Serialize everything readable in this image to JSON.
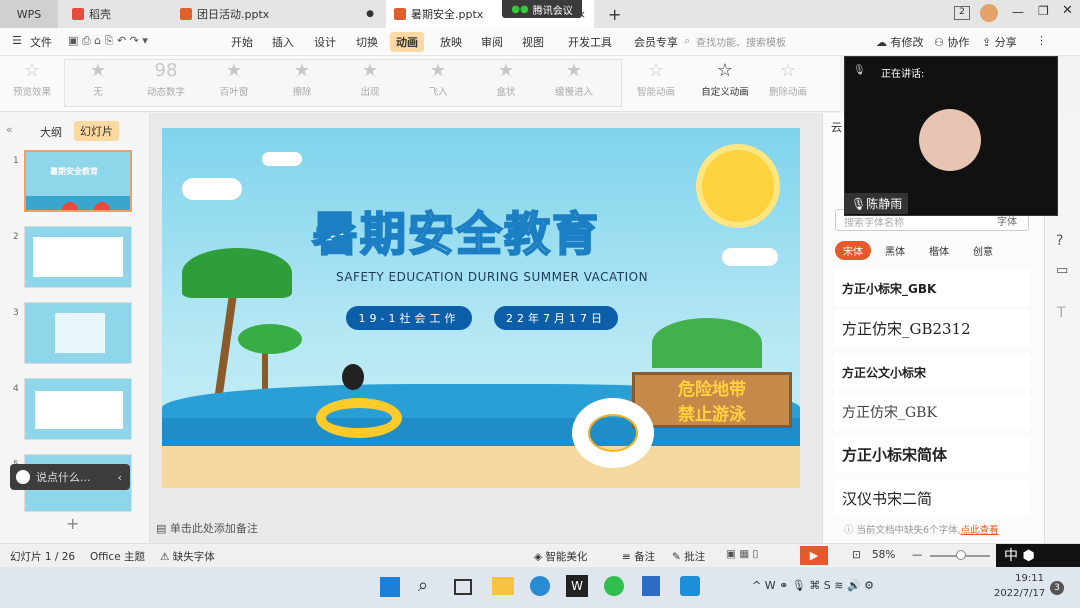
{
  "tabs": {
    "wps": "WPS",
    "docer": "稻壳",
    "file1": "团日活动.pptx",
    "file2": "暑期安全.pptx",
    "add": "+"
  },
  "meeting_badge": "腾讯会议",
  "window_controls": {
    "num": "2"
  },
  "menubar": {
    "file": "文件",
    "items": [
      "开始",
      "插入",
      "设计",
      "切换",
      "动画",
      "放映",
      "审阅",
      "视图",
      "开发工具",
      "会员专享"
    ],
    "search": "查找功能、搜索模板",
    "changes": "有修改",
    "collab": "协作",
    "share": "分享"
  },
  "ribbon": {
    "preview": "预览效果",
    "effects": [
      "无",
      "动态数字",
      "百叶窗",
      "擦除",
      "出现",
      "飞入",
      "盒状",
      "缓慢进入"
    ],
    "smart": "智能动画",
    "custom": "自定义动画",
    "delete": "删除动画"
  },
  "left_panel": {
    "outline": "大纲",
    "slides": "幻灯片",
    "nums": [
      "1",
      "2",
      "3",
      "4",
      "5"
    ],
    "chat": "说点什么...",
    "add": "+"
  },
  "slide": {
    "title": "暑期安全教育",
    "subtitle": "SAFETY EDUCATION DURING SUMMER VACATION",
    "class": "19-1社会工作",
    "date": "22年7月17日",
    "sign1": "危险地带",
    "sign2": "禁止游泳"
  },
  "right_panel": {
    "header": "云",
    "search_placeholder": "搜索字体名称",
    "search_btn": "字体",
    "cats": [
      "宋体",
      "黑体",
      "楷体",
      "创意"
    ],
    "fonts": [
      "方正小标宋_GBK",
      "方正仿宋_GB2312",
      "方正公文小标宋",
      "方正仿宋_GBK",
      "方正小标宋简体",
      "汉仪书宋二简"
    ],
    "missing": "当前文档中缺失6个字体,",
    "check": "点此查看"
  },
  "notes": "单击此处添加备注",
  "status": {
    "slide_no": "幻灯片 1 / 26",
    "theme": "Office 主题",
    "missing_font": "缺失字体",
    "beautify": "智能美化",
    "notes": "备注",
    "comment": "批注",
    "zoom": "58%",
    "ime": "中"
  },
  "meeting": {
    "speaking": "正在讲话:",
    "name": "陈静雨"
  },
  "taskbar": {
    "time": "19:11",
    "date": "2022/7/17",
    "badge": "3"
  },
  "colors": {
    "accent": "#e8582d",
    "active_tab": "#fff",
    "slide_blue": "#0d5ea8"
  }
}
